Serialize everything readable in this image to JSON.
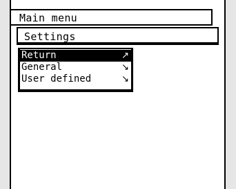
{
  "header": {
    "title": "Main menu"
  },
  "breadcrumb": {
    "current": "Settings"
  },
  "menu": {
    "items": [
      {
        "label": "Return",
        "arrow": "↗",
        "arrow_icon": "arrow-up-right-icon",
        "selected": true
      },
      {
        "label": "General",
        "arrow": "↘",
        "arrow_icon": "arrow-down-right-icon",
        "selected": false
      },
      {
        "label": "User defined",
        "arrow": "↘",
        "arrow_icon": "arrow-down-right-icon",
        "selected": false
      }
    ]
  },
  "colors": {
    "foreground": "#000000",
    "background": "#ffffff",
    "bezel": "#e6e6e6"
  }
}
